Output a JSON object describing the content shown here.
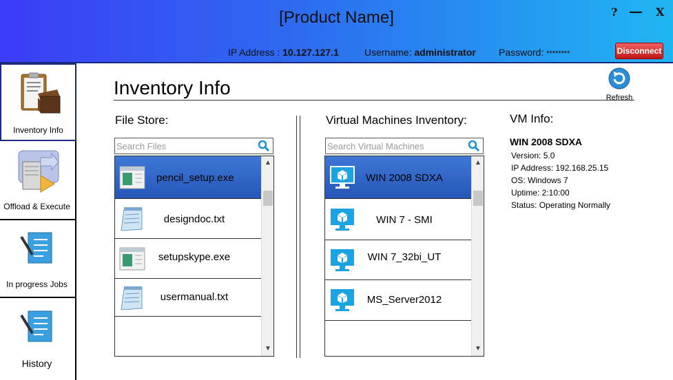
{
  "header": {
    "product_name": "[Product Name]",
    "help": "?",
    "minimize": "—",
    "close": "X",
    "ip_label": "IP Address :",
    "ip_value": "10.127.127.1",
    "username_label": "Username:",
    "username_value": "administrator",
    "password_label": "Password:",
    "password_value": "********",
    "disconnect": "Disconnect"
  },
  "sidebar": {
    "items": [
      {
        "label": "Inventory Info",
        "icon": "clipboard-box-icon",
        "active": true
      },
      {
        "label": "Offload & Execute",
        "icon": "server-arrow-icon"
      },
      {
        "label": "In progress Jobs",
        "icon": "checklist-pen-icon"
      },
      {
        "label": "History",
        "icon": "checklist-pen-icon"
      }
    ]
  },
  "main": {
    "title": "Inventory Info",
    "refresh_label": "Refresh"
  },
  "file_store": {
    "label": "File Store:",
    "search_placeholder": "Search Files",
    "files": [
      {
        "name": "pencil_setup.exe",
        "icon": "exe-window-icon",
        "selected": true
      },
      {
        "name": "designdoc.txt",
        "icon": "notepad-icon"
      },
      {
        "name": "setupskype.exe",
        "icon": "exe-window-icon"
      },
      {
        "name": "usermanual.txt",
        "icon": "notepad-icon"
      }
    ]
  },
  "vm_inventory": {
    "label": "Virtual Machines Inventory:",
    "search_placeholder": "Search Virtual Machines",
    "vms": [
      {
        "name": "WIN 2008 SDXA",
        "icon": "vm-monitor-icon",
        "selected": true
      },
      {
        "name": "WIN 7 - SMI",
        "icon": "vm-monitor-icon"
      },
      {
        "name": "WIN 7_32bi_UT",
        "icon": "vm-monitor-icon"
      },
      {
        "name": "MS_Server2012",
        "icon": "vm-monitor-icon"
      }
    ]
  },
  "vm_info": {
    "label": "VM Info:",
    "name": "WIN 2008 SDXA",
    "version": "Version: 5.0",
    "ip": "IP Address: 192.168.25.15",
    "os": "OS: Windows 7",
    "uptime": "Uptime: 2:10:00",
    "status": "Status: Operating Normally"
  },
  "colors": {
    "header_gradient_start": "#3b3cf5",
    "header_gradient_end": "#20b6f2",
    "selected_row": "#2f66c8",
    "disconnect": "#d02828",
    "vm_icon": "#1aa3e0"
  }
}
